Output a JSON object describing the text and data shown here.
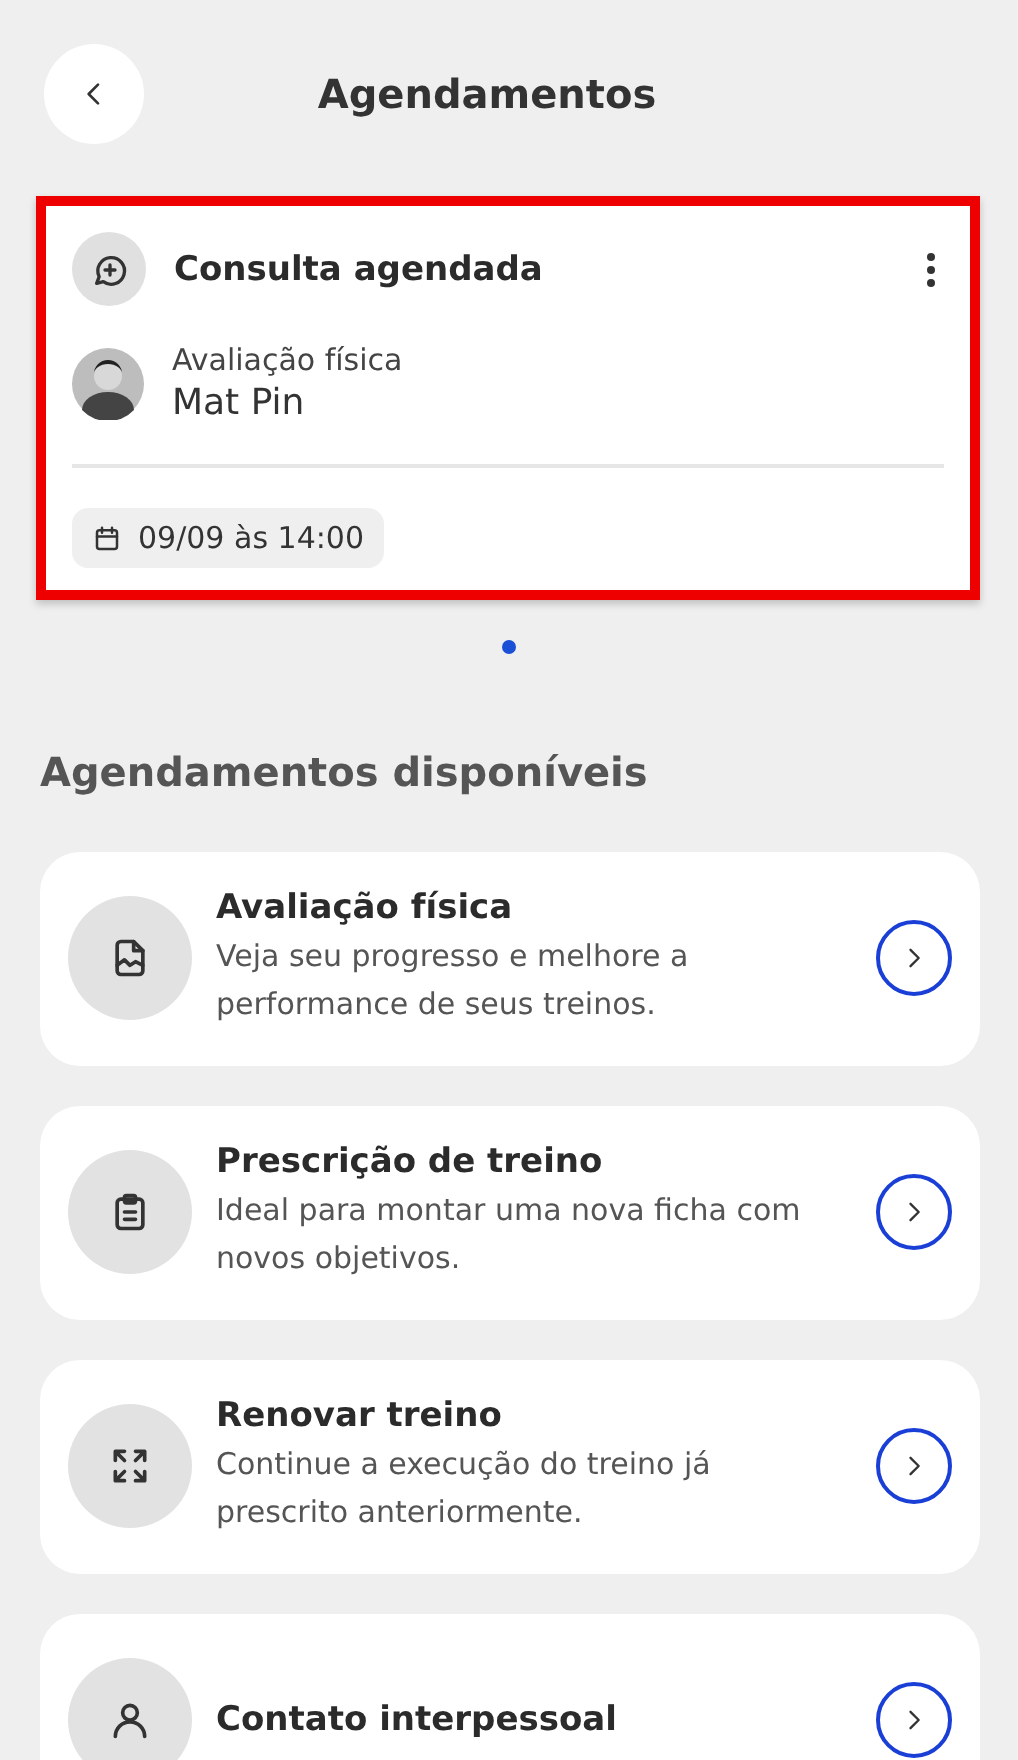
{
  "header": {
    "title": "Agendamentos"
  },
  "appointment": {
    "highlighted": true,
    "title": "Consulta agendada",
    "service": "Avaliação física",
    "person": "Mat Pin",
    "date": "09/09 às 14:00"
  },
  "carousel": {
    "pages": [
      {
        "selected": true
      }
    ]
  },
  "section_title": "Agendamentos disponíveis",
  "services": [
    {
      "title": "Avaliação física",
      "description": "Veja seu progresso e melhore a performance de seus treinos."
    },
    {
      "title": "Prescrição de treino",
      "description": "Ideal para montar uma nova ficha com novos objetivos."
    },
    {
      "title": "Renovar treino",
      "description": "Continue a execução do treino já prescrito anteriormente."
    },
    {
      "title": "Contato interpessoal"
    }
  ]
}
